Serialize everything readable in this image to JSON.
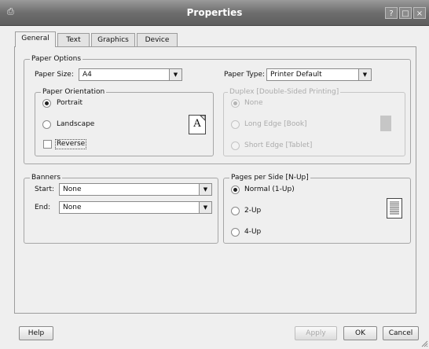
{
  "window": {
    "title": "Properties",
    "icon": "printer-icon",
    "controls": [
      "?",
      "□",
      "×"
    ]
  },
  "tabs": [
    "General",
    "Text",
    "Graphics",
    "Device"
  ],
  "active_tab": "General",
  "paper_options": {
    "title": "Paper Options",
    "paper_size_label": "Paper Size:",
    "paper_size_value": "A4",
    "paper_type_label": "Paper Type:",
    "paper_type_value": "Printer Default"
  },
  "orientation": {
    "title": "Paper Orientation",
    "portrait": "Portrait",
    "landscape": "Landscape",
    "reverse": "Reverse",
    "selected": "Portrait",
    "preview_glyph": "A"
  },
  "duplex": {
    "title": "Duplex [Double-Sided Printing]",
    "none": "None",
    "long_edge": "Long Edge [Book]",
    "short_edge": "Short Edge [Tablet]",
    "selected": "None",
    "enabled": false
  },
  "banners": {
    "title": "Banners",
    "start_label": "Start:",
    "start_value": "None",
    "end_label": "End:",
    "end_value": "None"
  },
  "nup": {
    "title": "Pages per Side [N-Up]",
    "normal": "Normal (1-Up)",
    "two": "2-Up",
    "four": "4-Up",
    "selected": "Normal (1-Up)"
  },
  "buttons": {
    "help": "Help",
    "apply": "Apply",
    "ok": "OK",
    "cancel": "Cancel"
  },
  "colors": {
    "titlebar": "#6e6e6e",
    "window_bg": "#efefef"
  }
}
